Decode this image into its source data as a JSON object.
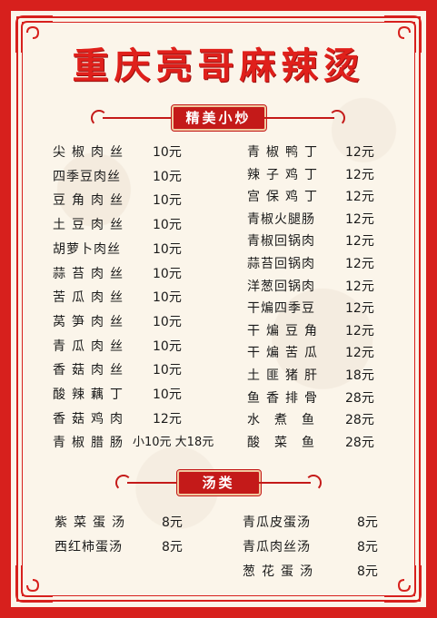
{
  "title": "重庆亮哥麻辣烫",
  "sections": {
    "stir_fry": {
      "heading": "精美小炒",
      "left": [
        {
          "name": "尖椒肉丝",
          "price": "10元"
        },
        {
          "name": "四季豆肉丝",
          "price": "10元"
        },
        {
          "name": "豆角肉丝",
          "price": "10元"
        },
        {
          "name": "土豆肉丝",
          "price": "10元"
        },
        {
          "name": "胡萝卜肉丝",
          "price": "10元"
        },
        {
          "name": "蒜苔肉丝",
          "price": "10元"
        },
        {
          "name": "苦瓜肉丝",
          "price": "10元"
        },
        {
          "name": "莴笋肉丝",
          "price": "10元"
        },
        {
          "name": "青瓜肉丝",
          "price": "10元"
        },
        {
          "name": "香菇肉丝",
          "price": "10元"
        },
        {
          "name": "酸辣藕丁",
          "price": "10元"
        },
        {
          "name": "香菇鸡肉",
          "price": "12元"
        },
        {
          "name": "青椒腊肠",
          "price": "小10元 大18元"
        }
      ],
      "right": [
        {
          "name": "青椒鸭丁",
          "price": "12元"
        },
        {
          "name": "辣子鸡丁",
          "price": "12元"
        },
        {
          "name": "宫保鸡丁",
          "price": "12元"
        },
        {
          "name": "青椒火腿肠",
          "price": "12元"
        },
        {
          "name": "青椒回锅肉",
          "price": "12元"
        },
        {
          "name": "蒜苔回锅肉",
          "price": "12元"
        },
        {
          "name": "洋葱回锅肉",
          "price": "12元"
        },
        {
          "name": "干煸四季豆",
          "price": "12元"
        },
        {
          "name": "干煸豆角",
          "price": "12元"
        },
        {
          "name": "干煸苦瓜",
          "price": "12元"
        },
        {
          "name": "土匪猪肝",
          "price": "18元"
        },
        {
          "name": "鱼香排骨",
          "price": "28元"
        },
        {
          "name": "水煮鱼",
          "price": "28元"
        },
        {
          "name": "酸菜鱼",
          "price": "28元"
        }
      ]
    },
    "soup": {
      "heading": "汤类",
      "left": [
        {
          "name": "紫菜蛋汤",
          "price": "8元"
        },
        {
          "name": "西红柿蛋汤",
          "price": "8元"
        }
      ],
      "right": [
        {
          "name": "青瓜皮蛋汤",
          "price": "8元"
        },
        {
          "name": "青瓜肉丝汤",
          "price": "8元"
        },
        {
          "name": "葱花蛋汤",
          "price": "8元"
        }
      ]
    }
  },
  "colors": {
    "accent": "#d7201d",
    "paper": "#fbf5ea",
    "text": "#1a1a1a"
  }
}
